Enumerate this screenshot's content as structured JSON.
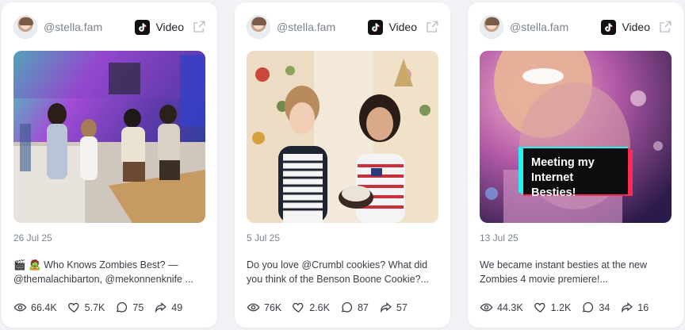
{
  "cards": [
    {
      "handle": "@stella.fam",
      "platform_label": "Video",
      "platform_icon": "tiktok-icon",
      "date": "26 Jul 25",
      "caption_line1": "🎬 🧟 Who Knows Zombies Best? —",
      "caption_line2": "@themalachibarton, @mekonnenknife ...",
      "views": "66.4K",
      "likes": "5.7K",
      "comments": "75",
      "shares": "49"
    },
    {
      "handle": "@stella.fam",
      "platform_label": "Video",
      "platform_icon": "tiktok-icon",
      "date": "5 Jul 25",
      "caption_line1": "Do you love @Crumbl cookies? What did",
      "caption_line2": "you think of the Benson Boone Cookie?...",
      "views": "76K",
      "likes": "2.6K",
      "comments": "87",
      "shares": "57"
    },
    {
      "handle": "@stella.fam",
      "platform_label": "Video",
      "platform_icon": "tiktok-icon",
      "date": "13 Jul 25",
      "caption_line1": "We became instant besties at the new",
      "caption_line2": "Zombies 4 movie premiere!...",
      "overlay_line1": "Meeting my",
      "overlay_line2": "Internet Besties!",
      "views": "44.3K",
      "likes": "1.2K",
      "comments": "34",
      "shares": "16"
    }
  ],
  "colors": {
    "card_bg": "#ffffff",
    "page_bg": "#f1f2f5",
    "muted_text": "#7c8290",
    "text": "#3a3d45"
  }
}
